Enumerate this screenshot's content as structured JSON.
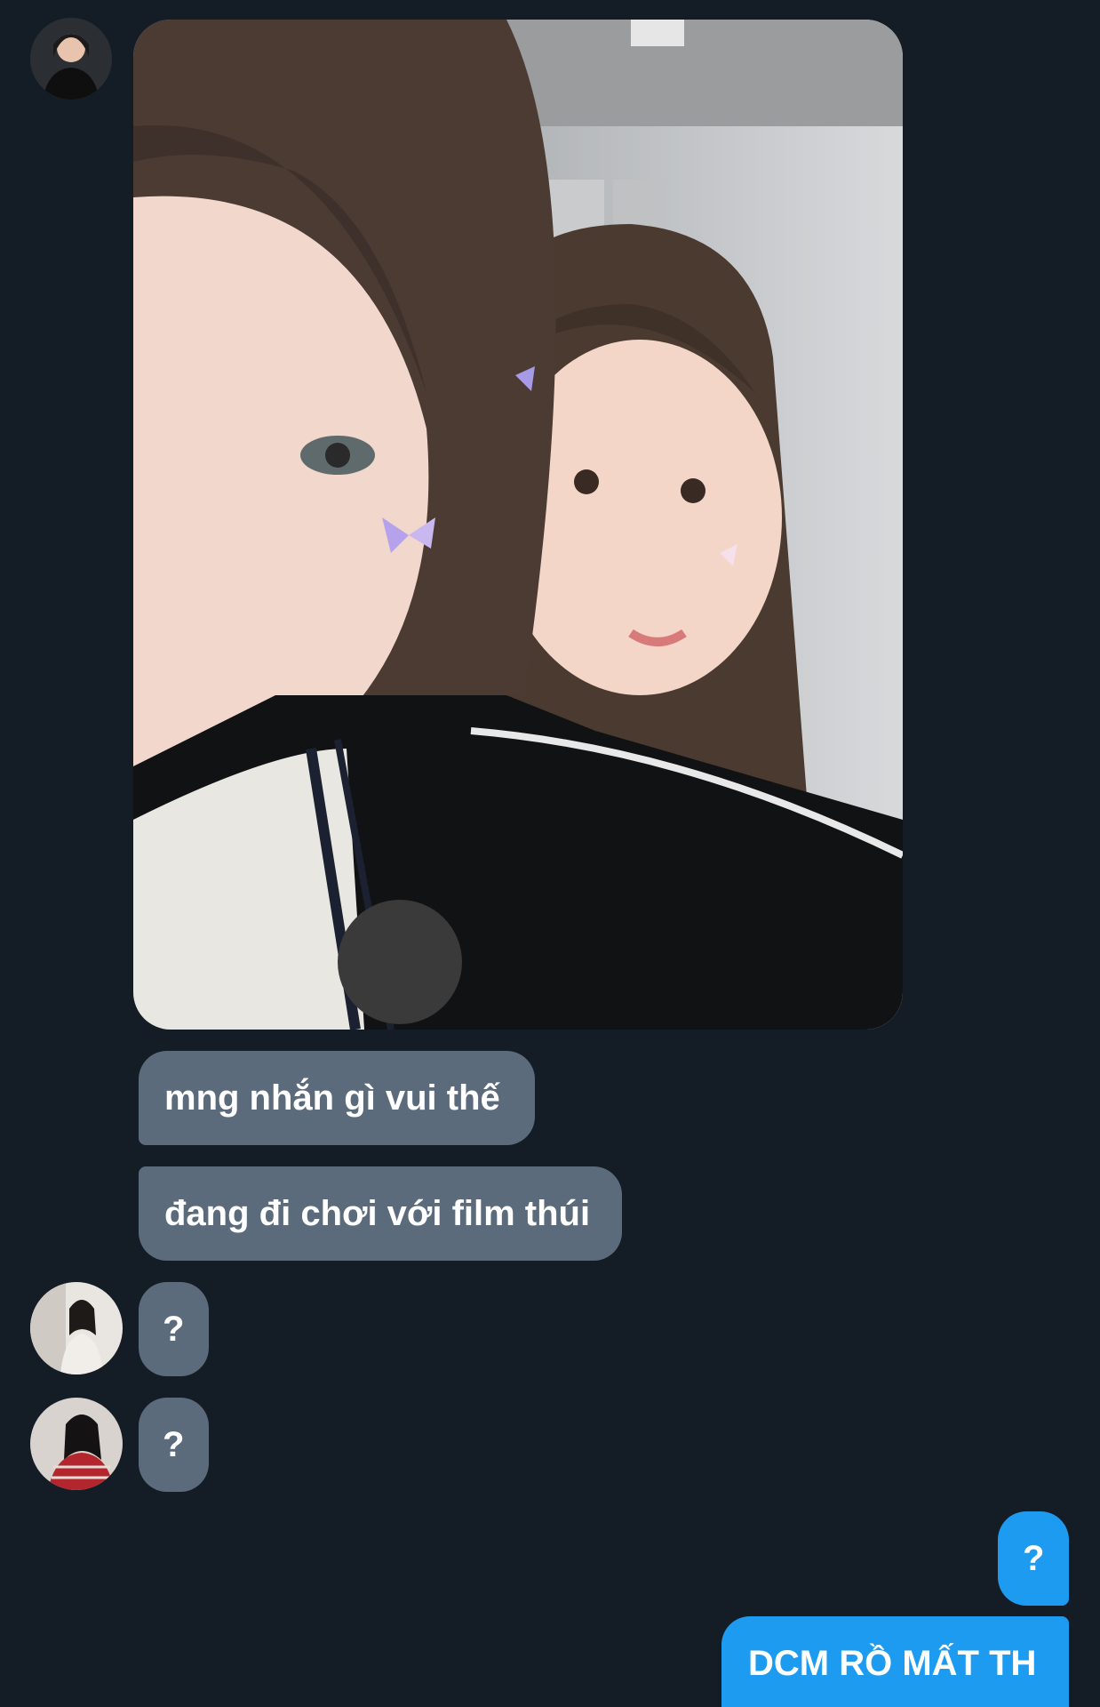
{
  "conversation": {
    "incoming": [
      {
        "text": "mng nhắn gì vui thế"
      },
      {
        "text": "đang đi chơi với film thúi"
      },
      {
        "text": "?"
      },
      {
        "text": "?"
      }
    ],
    "outgoing": [
      {
        "text": "?"
      },
      {
        "text": "DCM RỒ MẤT TH"
      }
    ]
  },
  "colors": {
    "background": "#141d26",
    "incoming_bubble": "#5c6b7c",
    "outgoing_bubble": "#1d9bf0",
    "text": "#ffffff"
  }
}
